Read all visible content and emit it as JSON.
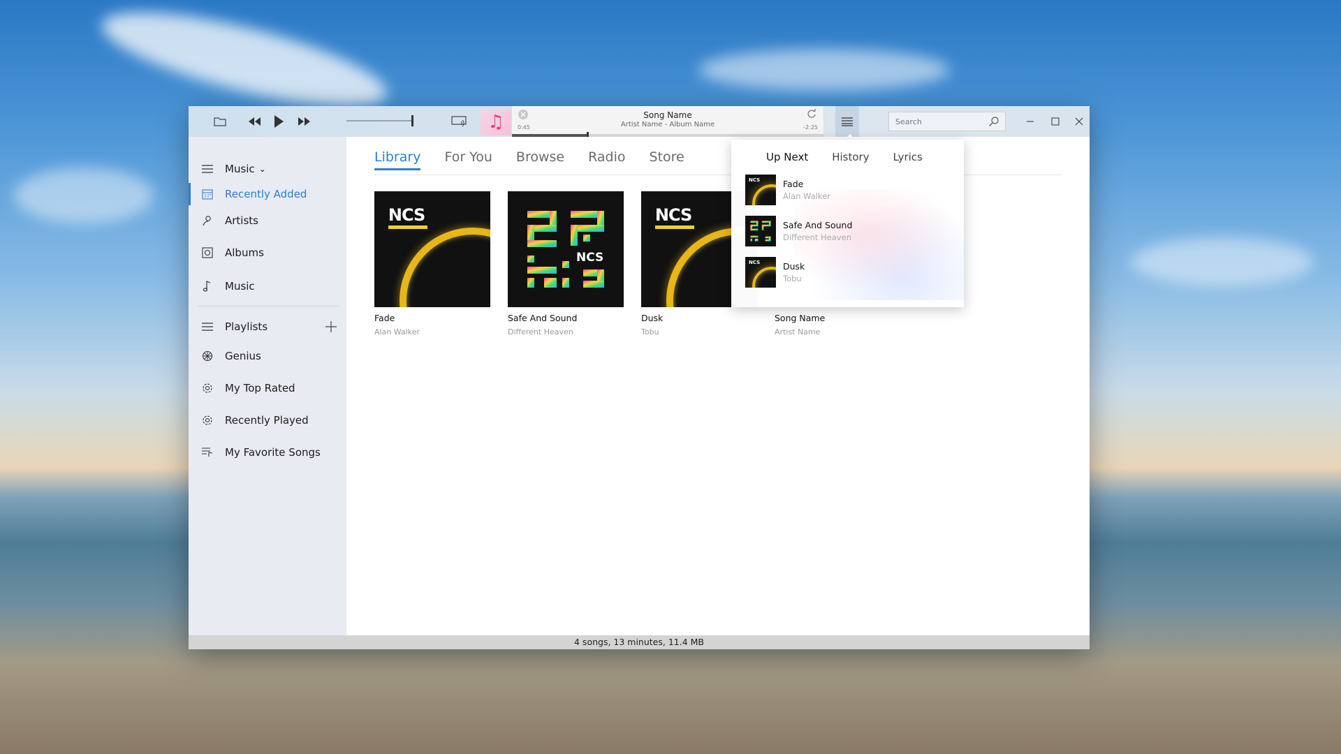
{
  "window": {
    "now_playing": {
      "song": "Song Name",
      "artist_album": "Artist Name - Album Name",
      "elapsed": "0:45",
      "remaining": "-2:25",
      "progress": 0.24
    },
    "volume_level": 0.97,
    "search_placeholder": "Search"
  },
  "sidebar": {
    "library_selector": "Music",
    "items": [
      {
        "label": "Recently Added",
        "icon": "calendar-icon",
        "active": true
      },
      {
        "label": "Artists",
        "icon": "person-icon"
      },
      {
        "label": "Albums",
        "icon": "album-icon"
      },
      {
        "label": "Music",
        "icon": "music-note-icon"
      }
    ],
    "playlists_label": "Playlists",
    "playlists": [
      {
        "label": "Genius",
        "icon": "genius-icon"
      },
      {
        "label": "My Top Rated",
        "icon": "gear-icon"
      },
      {
        "label": "Recently Played",
        "icon": "gear-icon"
      },
      {
        "label": "My Favorite Songs",
        "icon": "playlist-icon"
      }
    ]
  },
  "main": {
    "tabs": [
      "Library",
      "For You",
      "Browse",
      "Radio",
      "Store"
    ],
    "active_tab": "Library",
    "albums": [
      {
        "title": "Fade",
        "artist": "Alan Walker",
        "art": "ncs"
      },
      {
        "title": "Safe And Sound",
        "artist": "Different Heaven",
        "art": "qr"
      },
      {
        "title": "Dusk",
        "artist": "Tobu",
        "art": "ncs"
      },
      {
        "title": "Song Name",
        "artist": "Artist Name",
        "art": "hidden"
      }
    ]
  },
  "up_next": {
    "tabs": [
      "Up Next",
      "History",
      "Lyrics"
    ],
    "items": [
      {
        "title": "Fade",
        "artist": "Alan Walker",
        "art": "ncs"
      },
      {
        "title": "Safe And Sound",
        "artist": "Different Heaven",
        "art": "qr"
      },
      {
        "title": "Dusk",
        "artist": "Tobu",
        "art": "ncs"
      }
    ]
  },
  "status_bar": "4 songs, 13 minutes, 11.4 MB",
  "colors": {
    "accent": "#2a7fd4",
    "ring_gold": "#e8b618"
  }
}
